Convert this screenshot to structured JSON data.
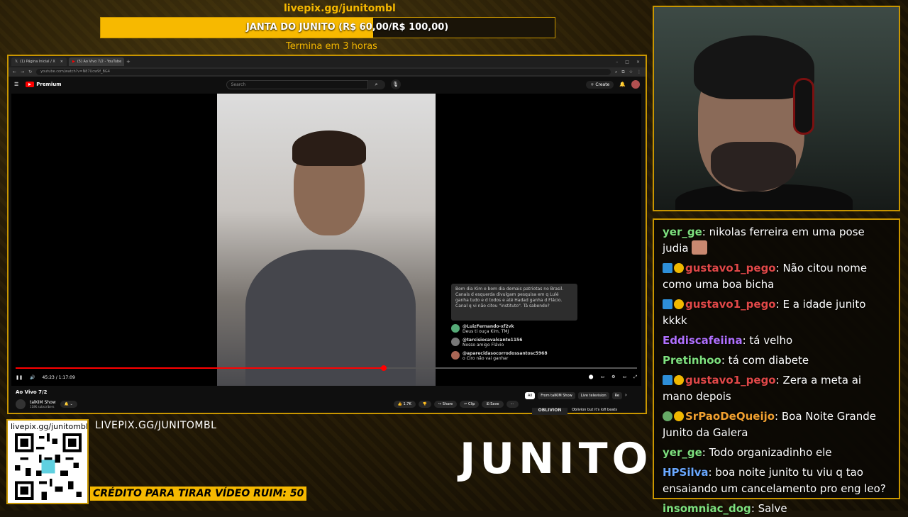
{
  "goal": {
    "url": "livepix.gg/junitombl",
    "label": "JANTA DO JUNITO (R$ 60,00/R$ 100,00)",
    "current": 60,
    "target": 100,
    "ends": "Termina em 3 horas",
    "accent": "#f7b900"
  },
  "browser": {
    "tabs": [
      {
        "title": "(1) Página Inicial / X"
      },
      {
        "title": "(5) Ao Vivo 7/2 - YouTube"
      }
    ],
    "address": "youtube.com/watch?v=N87Ucw9f_BG4",
    "search_placeholder": "Search",
    "premium_label": "Premium",
    "create_label": "+ Create",
    "time": "45:23 / 1:17:09",
    "progress_fraction": 0.592,
    "video_title": "Ao Vivo 7/2",
    "channel": "talKIM Show",
    "subscribers": "118K subscribers",
    "likes": "1.7K",
    "share_label": "Share",
    "clip_label": "Clip",
    "save_label": "Save",
    "chips": [
      "All",
      "From talKIM Show",
      "Live television",
      "Re"
    ],
    "rec_thumb_text": "OBLIVION",
    "rec_title": "Oblivion but it's lofi beats",
    "overlay_chat": {
      "pinned": "Bom dia Kim e bom dia demais patriotas no Brasil. Canais d esquerda divulgam pesquisa em q Lulé ganha tudo e d todos e até Hadad ganha d Flácio. Canal q vi não citou \"instituto\". Tá sabendo?",
      "messages": [
        {
          "user": "@LuizFernando-xf2vk",
          "text": "Deus ti ouça Kim, TMJ"
        },
        {
          "user": "@tarcisiocavalcante1156",
          "text": "Nosso amigo Flávio"
        },
        {
          "user": "@aparecidasocorrodossantosc5968",
          "text": "o Ciro não vai ganhar"
        }
      ]
    }
  },
  "chat": [
    {
      "user": "yer_ge",
      "color": "#7ee07e",
      "text": ": nikolas ferreira em uma pose judia",
      "badges": [],
      "emote": true
    },
    {
      "user": "gustavo1_pego",
      "color": "#e04848",
      "text": ": Não citou nome como uma boa bicha",
      "badges": [
        "prime",
        "coin"
      ]
    },
    {
      "user": "gustavo1_pego",
      "color": "#e04848",
      "text": ": E a idade junito kkkk",
      "badges": [
        "prime",
        "coin"
      ]
    },
    {
      "user": "Eddiscafeiina",
      "color": "#b070ff",
      "text": ": tá velho",
      "badges": []
    },
    {
      "user": "Pretinhoo",
      "color": "#7ee07e",
      "text": ": tá com diabete",
      "badges": []
    },
    {
      "user": "gustavo1_pego",
      "color": "#e04848",
      "text": ": Zera a meta ai mano depois",
      "badges": [
        "prime",
        "coin"
      ]
    },
    {
      "user": "SrPaoDeQueijo",
      "color": "#f0a030",
      "text": ": Boa Noite Grande Junito da Galera",
      "badges": [
        "hype",
        "coin"
      ]
    },
    {
      "user": "yer_ge",
      "color": "#7ee07e",
      "text": ": Todo organizadinho ele",
      "badges": []
    },
    {
      "user": "HPSilva",
      "color": "#6aa8ff",
      "text": ": boa noite junito tu viu q tao ensaiando um cancelamento pro eng leo?",
      "badges": []
    },
    {
      "user": "insomniac_dog",
      "color": "#7ee07e",
      "text": ": Salve",
      "badges": []
    }
  ],
  "overlay": {
    "qr_url": "livepix.gg/junitombl",
    "livepix": "LIVEPIX.GG/JUNITOMBL",
    "credit": "CRÉDITO PARA TIRAR VÍDEO RUIM: 50",
    "brand": "JUNITO"
  }
}
